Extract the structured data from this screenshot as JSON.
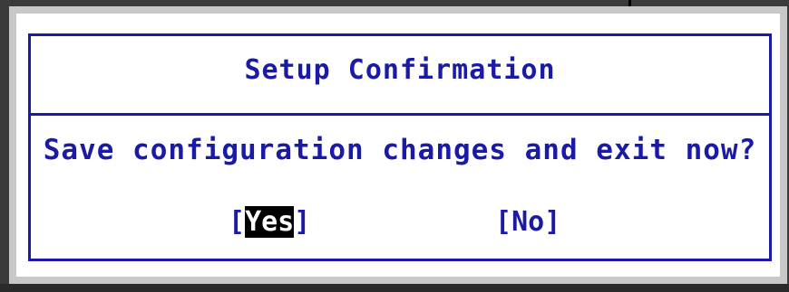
{
  "dialog": {
    "title": "Setup Confirmation",
    "message": "Save configuration changes and exit now?",
    "options": [
      {
        "label": "Yes",
        "selected": true
      },
      {
        "label": "No",
        "selected": false
      }
    ],
    "bracket_open": "[",
    "bracket_close": "]"
  },
  "colors": {
    "text": "#1a1aa6",
    "selected_bg": "#000000",
    "selected_fg": "#ffffff",
    "panel_bg": "#ffffff",
    "frame": "#c8c8c8"
  }
}
